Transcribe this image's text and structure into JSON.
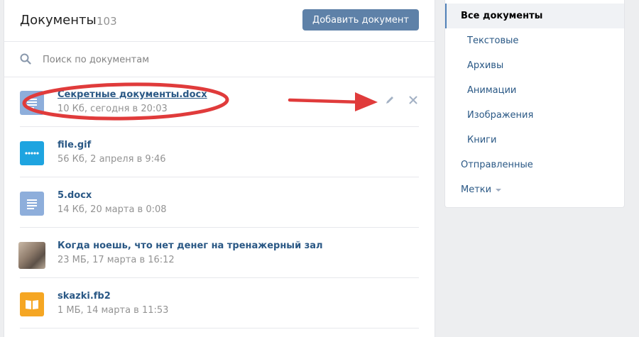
{
  "header": {
    "title": "Документы",
    "count": "103",
    "add_button": "Добавить документ"
  },
  "search": {
    "placeholder": "Поиск по документам",
    "icon": "search-icon"
  },
  "documents": [
    {
      "name": "Секретные документы.docx",
      "meta": "10 Кб, сегодня в 20:03",
      "icon": "text-doc-icon",
      "color": "#8eaedb"
    },
    {
      "name": "file.gif",
      "meta": "56 Кб, 2 апреля в 9:46",
      "icon": "gif-icon",
      "color": "#1ea4e0"
    },
    {
      "name": "5.docx",
      "meta": "14 Кб, 20 марта в 0:08",
      "icon": "text-doc-icon",
      "color": "#8eaedb"
    },
    {
      "name": "Когда ноешь, что нет денег на тренажерный зал",
      "meta": "23 МБ, 17 марта в 16:12",
      "icon": "photo-thumbnail",
      "color": "#a08878"
    },
    {
      "name": "skazki.fb2",
      "meta": "1 МБ, 14 марта в 11:53",
      "icon": "book-icon",
      "color": "#f5a623"
    }
  ],
  "row_actions": {
    "edit": "edit-pencil-icon",
    "delete": "close-icon"
  },
  "sidebar": {
    "items": [
      {
        "label": "Все документы"
      },
      {
        "label": "Текстовые"
      },
      {
        "label": "Архивы"
      },
      {
        "label": "Анимации"
      },
      {
        "label": "Изображения"
      },
      {
        "label": "Книги"
      },
      {
        "label": "Отправленные"
      },
      {
        "label": "Метки"
      }
    ]
  },
  "annotation": {
    "color": "#e03b3b"
  }
}
